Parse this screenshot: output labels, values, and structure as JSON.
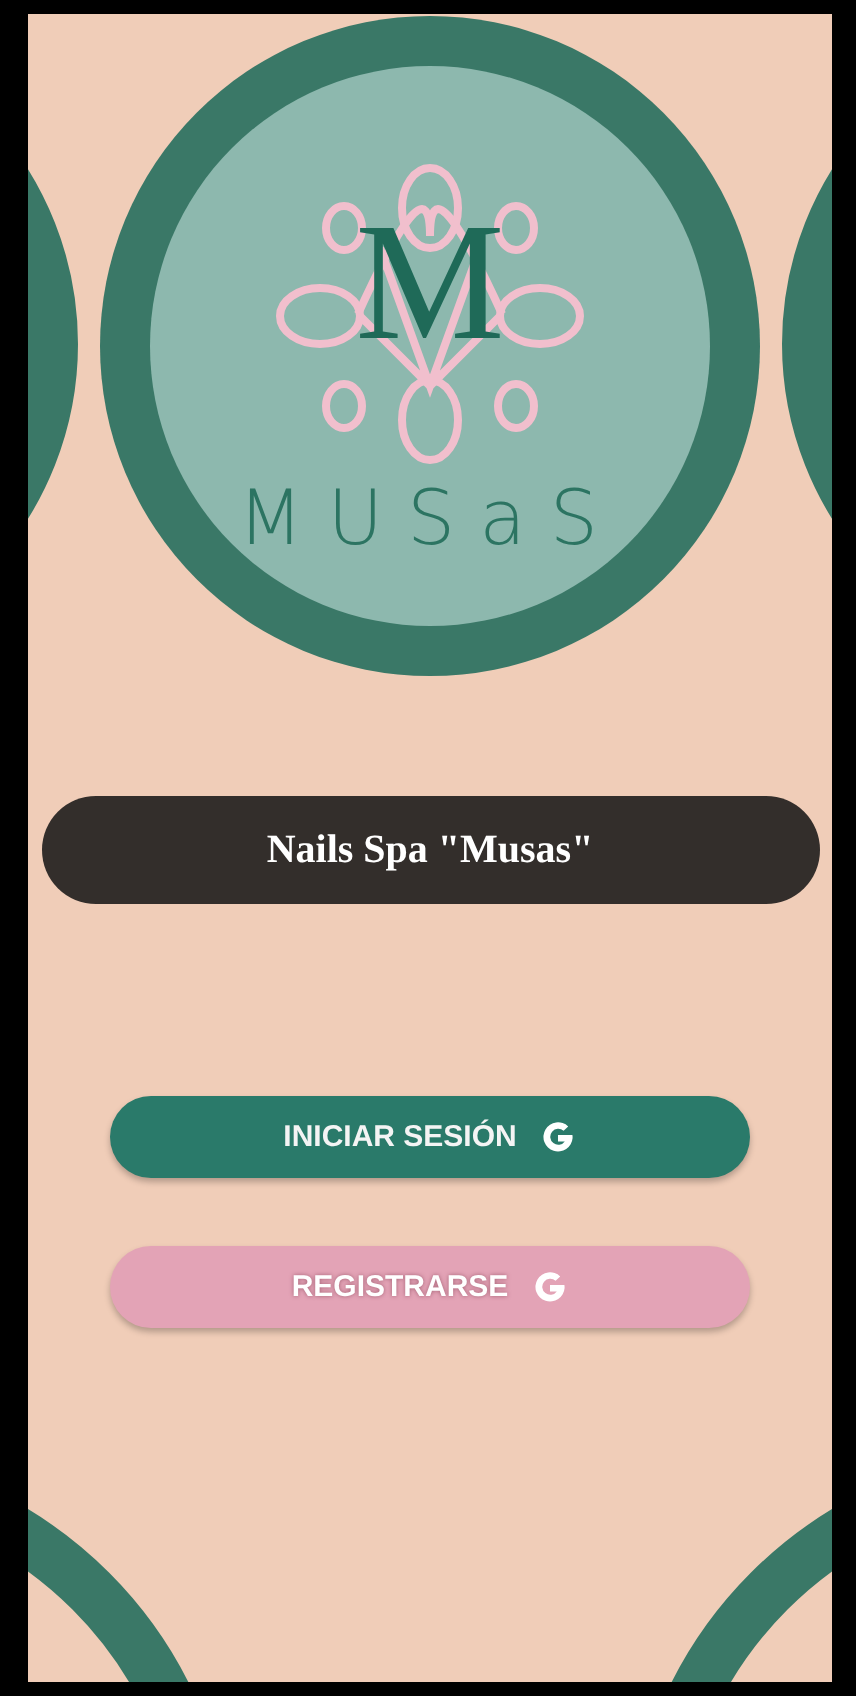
{
  "logo": {
    "monogram": "M",
    "wordmark": "MUSaS"
  },
  "title": "Nails Spa \"Musas\"",
  "buttons": [
    {
      "label": "INICIAR SESIÓN",
      "kind": "primary"
    },
    {
      "label": "REGISTRARSE",
      "kind": "secondary"
    }
  ]
}
